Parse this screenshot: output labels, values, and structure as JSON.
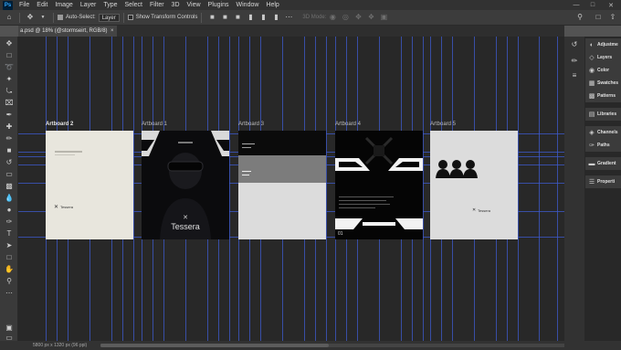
{
  "app": {
    "logo_text": "Ps"
  },
  "menu": [
    "File",
    "Edit",
    "Image",
    "Layer",
    "Type",
    "Select",
    "Filter",
    "3D",
    "View",
    "Plugins",
    "Window",
    "Help"
  ],
  "options": {
    "auto_select_label": "Auto-Select:",
    "auto_select_value": "Layer",
    "transform_label": "Show Transform Controls",
    "mode_3d_label": "3D Mode:"
  },
  "document": {
    "tab_title": "a.psd @ 18% (@stormseirt, RGB/8)"
  },
  "artboards": [
    {
      "label": "Artboard 2",
      "texts": [
        "Tessera"
      ]
    },
    {
      "label": "Artboard 1",
      "texts": [
        "Tessera"
      ]
    },
    {
      "label": "Artboard 3",
      "texts": []
    },
    {
      "label": "Artboard 4",
      "texts": [
        "01"
      ]
    },
    {
      "label": "Artboard 5",
      "texts": [
        "Tessera"
      ]
    }
  ],
  "status": {
    "text": "5800 px x 1320 px (96 ppi)"
  },
  "panels": [
    {
      "label": "Adjustme",
      "icon": "adjustments-icon"
    },
    {
      "label": "Layers",
      "icon": "layers-icon"
    },
    {
      "label": "Color",
      "icon": "color-icon"
    },
    {
      "label": "Swatches",
      "icon": "swatches-icon"
    },
    {
      "label": "Patterns",
      "icon": "patterns-icon"
    },
    {
      "label": "Libraries",
      "icon": "libraries-icon"
    },
    {
      "label": "Channels",
      "icon": "channels-icon"
    },
    {
      "label": "Paths",
      "icon": "paths-icon"
    },
    {
      "label": "Gradient",
      "icon": "gradient-icon"
    },
    {
      "label": "Properti",
      "icon": "properties-icon"
    }
  ],
  "colors": {
    "foreground": "#11c01a",
    "background": "#000000",
    "guide": "#3d5bd0",
    "canvas": "#282828"
  }
}
